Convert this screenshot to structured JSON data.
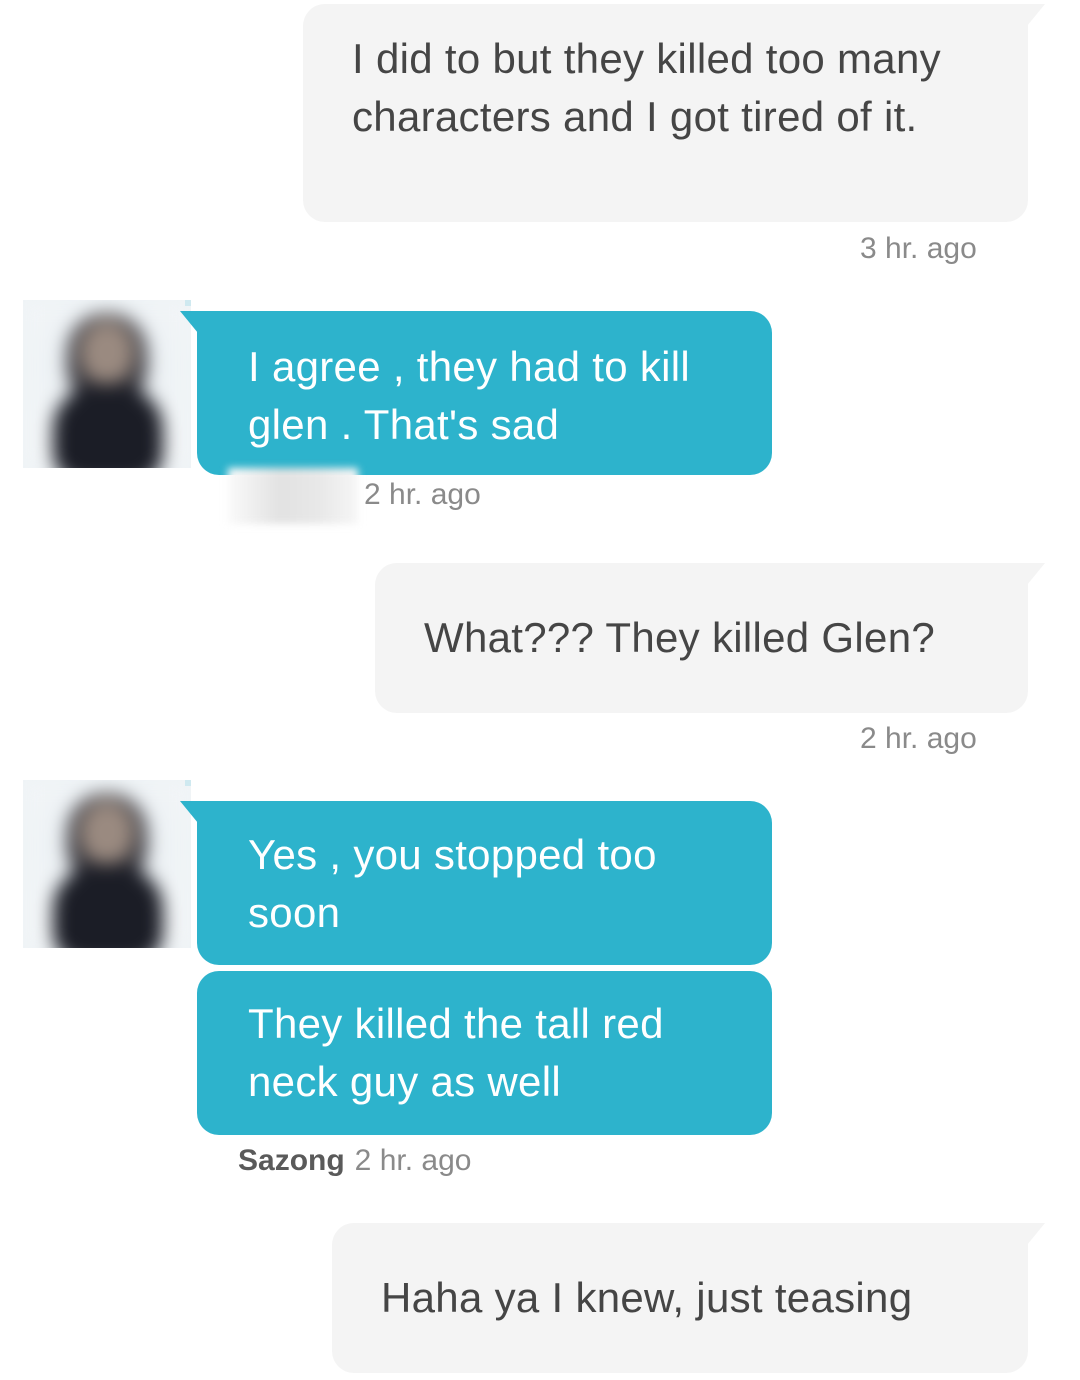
{
  "messages": [
    {
      "text": "I did to but they killed too many characters and I got tired of it.",
      "time": "3 hr. ago"
    },
    {
      "text": "I agree , they had to kill glen . That's sad",
      "time": "2 hr. ago"
    },
    {
      "text": "What??? They killed Glen?",
      "time": "2 hr. ago"
    },
    {
      "text": "Yes , you stopped too soon"
    },
    {
      "text": "They killed the tall red neck guy as well",
      "sender": "Sazong",
      "time": "2 hr. ago"
    },
    {
      "text": "Haha ya I knew, just teasing"
    }
  ],
  "colors": {
    "incoming_bubble": "#2db3cc",
    "outgoing_bubble": "#f4f4f4",
    "outgoing_text": "#454545",
    "timestamp": "#8a8a8a"
  },
  "icons": {
    "avatar": "avatar-icon"
  }
}
